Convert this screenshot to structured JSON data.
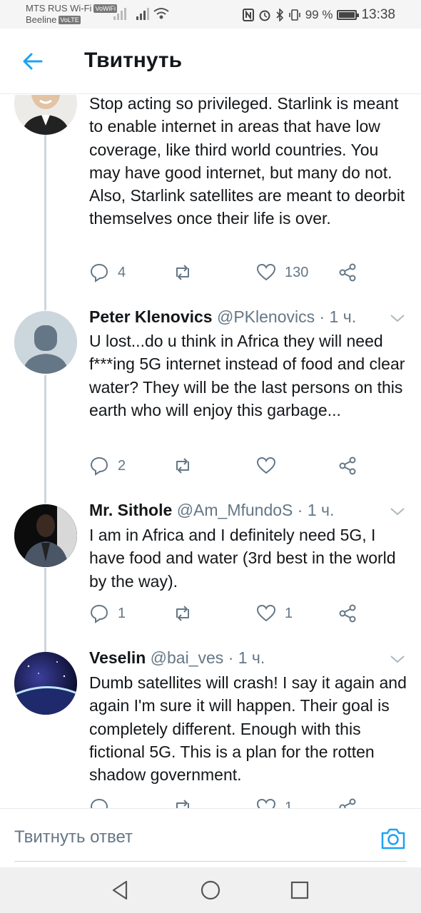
{
  "status_bar": {
    "carrier1": "MTS RUS Wi-Fi",
    "carrier1_tag": "VoWiFi",
    "carrier2": "Beeline",
    "carrier2_tag": "VoLTE",
    "battery": "99 %",
    "time": "13:38",
    "icons": [
      "nfc-icon",
      "alarm-icon",
      "bluetooth-icon",
      "vibrate-icon",
      "battery-icon"
    ]
  },
  "header": {
    "title": "Твитнуть",
    "back_icon": "arrow-left-icon"
  },
  "tweets": [
    {
      "name": "",
      "handle": "",
      "time": "",
      "text": "Stop acting so privileged. Starlink is meant to enable internet in areas that have low coverage, like third world countries. You may have good internet, but many do not. Also, Starlink satellites are meant to deorbit themselves once their life is over.",
      "replies": "4",
      "retweets": "",
      "likes": "130"
    },
    {
      "name": "Peter Klenovics",
      "handle": "@PKlenovics",
      "time": "· 1 ч.",
      "text": "U lost...do u think in Africa they will need f***ing 5G internet instead of food and clear water? They will be the last persons on this earth who will enjoy this garbage...",
      "replies": "2",
      "retweets": "",
      "likes": ""
    },
    {
      "name": "Mr. Sithole",
      "handle": "@Am_MfundoS",
      "time": "· 1 ч.",
      "text": "I am in Africa and I definitely need 5G, I have food and water (3rd best in the world by the way).",
      "replies": "1",
      "retweets": "",
      "likes": "1"
    },
    {
      "name": "Veselin",
      "handle": "@bai_ves",
      "time": "· 1 ч.",
      "text": "Dumb satellites will crash! I say it again and again I'm sure it will happen. Their goal is completely different. Enough with this fictional 5G. This is a plan for the rotten shadow government.",
      "replies": "",
      "retweets": "",
      "likes": "1"
    }
  ],
  "reply_bar": {
    "placeholder": "Твитнуть ответ"
  },
  "colors": {
    "accent": "#1da1f2",
    "secondary_text": "#657786",
    "thread_line": "#ccd6dd"
  }
}
